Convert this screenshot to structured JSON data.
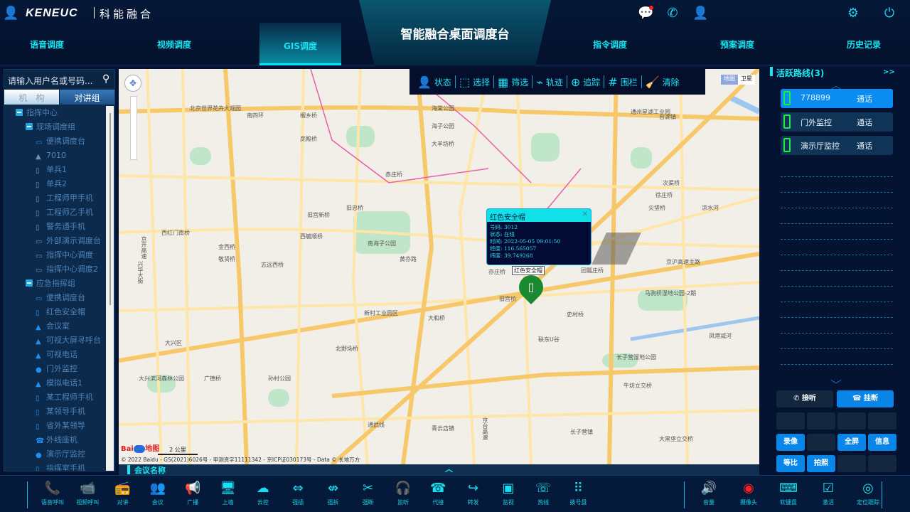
{
  "header": {
    "logo_text": "KENEUC",
    "logo_cn": "科能融合",
    "title": "智能融合桌面调度台",
    "nav": [
      {
        "label": "语音调度",
        "active": false
      },
      {
        "label": "视频调度",
        "active": false
      },
      {
        "label": "GIS调度",
        "active": true
      },
      {
        "label": "指令调度",
        "active": false
      },
      {
        "label": "预案调度",
        "active": false
      },
      {
        "label": "历史记录",
        "active": false
      }
    ],
    "icons": [
      "chat-icon",
      "phone-icon",
      "user-settings-icon",
      "gear-icon",
      "power-icon"
    ]
  },
  "left": {
    "search_placeholder": "请输入用户名或号码...",
    "tabs": [
      {
        "label": "机　构",
        "active": true
      },
      {
        "label": "对讲组",
        "active": false
      }
    ],
    "tree": [
      {
        "label": "指挥中心",
        "level": 0,
        "icon": "collapse"
      },
      {
        "label": "现场调度组",
        "level": 1,
        "icon": "collapse"
      },
      {
        "label": "便携调度台",
        "level": 2,
        "icon": "monitor",
        "online": true
      },
      {
        "label": "7010",
        "level": 2,
        "icon": "user",
        "online": false
      },
      {
        "label": "单兵1",
        "level": 2,
        "icon": "mobile",
        "online": false
      },
      {
        "label": "单兵2",
        "level": 2,
        "icon": "mobile",
        "online": false
      },
      {
        "label": "工程师甲手机",
        "level": 2,
        "icon": "mobile",
        "online": false
      },
      {
        "label": "工程师乙手机",
        "level": 2,
        "icon": "mobile",
        "online": false
      },
      {
        "label": "警务通手机",
        "level": 2,
        "icon": "mobile",
        "online": false
      },
      {
        "label": "外部演示调度台",
        "level": 2,
        "icon": "monitor",
        "online": false
      },
      {
        "label": "指挥中心调度",
        "level": 2,
        "icon": "monitor",
        "online": false
      },
      {
        "label": "指挥中心调度2",
        "level": 2,
        "icon": "monitor",
        "online": false
      },
      {
        "label": "应急指挥组",
        "level": 1,
        "icon": "collapse"
      },
      {
        "label": "便携调度台",
        "level": 2,
        "icon": "monitor",
        "online": true
      },
      {
        "label": "红色安全帽",
        "level": 2,
        "icon": "mobile",
        "online": true
      },
      {
        "label": "会议室",
        "level": 2,
        "icon": "user",
        "online": true
      },
      {
        "label": "可视大屏寻呼台",
        "level": 2,
        "icon": "user",
        "online": true
      },
      {
        "label": "可视电话",
        "level": 2,
        "icon": "user",
        "online": true
      },
      {
        "label": "门外监控",
        "level": 2,
        "icon": "camera",
        "online": true
      },
      {
        "label": "模拟电话1",
        "level": 2,
        "icon": "user",
        "online": true
      },
      {
        "label": "某工程师手机",
        "level": 2,
        "icon": "mobile",
        "online": true
      },
      {
        "label": "某领导手机",
        "level": 2,
        "icon": "mobile",
        "online": true
      },
      {
        "label": "省外某领导",
        "level": 2,
        "icon": "mobile",
        "online": true
      },
      {
        "label": "外线座机",
        "level": 2,
        "icon": "phone",
        "online": true
      },
      {
        "label": "演示厅监控",
        "level": 2,
        "icon": "camera",
        "online": true
      },
      {
        "label": "指挥室手机",
        "level": 2,
        "icon": "mobile",
        "online": true
      }
    ]
  },
  "map": {
    "toolbar": [
      {
        "label": "状态",
        "icon": "user-icon"
      },
      {
        "label": "选择",
        "icon": "select-icon"
      },
      {
        "label": "筛选",
        "icon": "filter-icon"
      },
      {
        "label": "轨迹",
        "icon": "track-icon"
      },
      {
        "label": "追踪",
        "icon": "target-icon"
      },
      {
        "label": "围栏",
        "icon": "fence-icon"
      },
      {
        "label": "清除",
        "icon": "broom-icon"
      }
    ],
    "map_type": [
      "地图",
      "卫星"
    ],
    "popup": {
      "title": "红色安全帽",
      "rows": [
        "号码:  3012",
        "状态:  在线",
        "时间:  2022-05-05 09:01:50",
        "经度:  116.565057",
        "纬度:  39.749268"
      ]
    },
    "marker_label": "红色安全帽",
    "scale": "2 公里",
    "copyright": "© 2022 Baidu - GS(2021)6026号 - 甲测资字11111342 - 京ICP证030173号 - Data © 长地万方",
    "baidu_logo": "Bai度地图",
    "places": [
      "南四环",
      "北京世界花卉大观园",
      "榴乡桥",
      "庑殿桥",
      "海棠公园",
      "大羊坊桥",
      "赤庄桥",
      "旧忠桥",
      "旧宫新桥",
      "西红门南桥",
      "金西桥",
      "敬贤桥",
      "西毓顺桥",
      "南海子公园",
      "黄亦路",
      "志远西桥",
      "亦庄桥",
      "团瓢庄桥",
      "京沪高速主路",
      "新村工业园区",
      "大和桥",
      "旧宫桥",
      "史村桥",
      "联东U谷",
      "大兴区",
      "北野场桥",
      "孙村公园",
      "广德桥",
      "通武线",
      "青云店镇",
      "长子营镇",
      "牛坊立交桥",
      "大黑垡立交桥",
      "通州星湖工业园",
      "台湖镇",
      "次渠桥",
      "尖垡桥",
      "徐庄桥",
      "马驹桥湿地公园-2期",
      "长子营湿地公园",
      "凉水河",
      "凤港减河",
      "京台高速",
      "兴华大街",
      "京开高速",
      "海子公园",
      "大兴滨河森林公园"
    ]
  },
  "meeting": {
    "title": "会议名称"
  },
  "right": {
    "title": "活跃路线(3)",
    "more": ">>",
    "calls": [
      {
        "name": "778899",
        "status": "通话",
        "selected": true
      },
      {
        "name": "门外监控",
        "status": "通话",
        "selected": false
      },
      {
        "name": "演示厅监控",
        "status": "通话",
        "selected": false
      }
    ],
    "answer": "接听",
    "hangup": "挂断",
    "grid": [
      "",
      "",
      "",
      "",
      "录像",
      "",
      "全屏",
      "信息",
      "等比",
      "拍照",
      "",
      ""
    ]
  },
  "bottom": {
    "left": [
      {
        "label": "语音呼叫",
        "icon": "voice-call-icon",
        "glyph": "📞"
      },
      {
        "label": "视频呼叫",
        "icon": "video-call-icon",
        "glyph": "📹"
      },
      {
        "label": "对讲",
        "icon": "walkie-talkie-icon",
        "glyph": "📻"
      },
      {
        "label": "会议",
        "icon": "meeting-icon",
        "glyph": "👥"
      },
      {
        "label": "广播",
        "icon": "broadcast-icon",
        "glyph": "📢"
      },
      {
        "label": "上墙",
        "icon": "screen-wall-icon",
        "glyph": "🖥"
      },
      {
        "label": "云控",
        "icon": "cloud-control-icon",
        "glyph": "☁"
      },
      {
        "label": "强插",
        "icon": "force-insert-icon",
        "glyph": "⇔"
      },
      {
        "label": "强拆",
        "icon": "force-remove-icon",
        "glyph": "⇎"
      },
      {
        "label": "强断",
        "icon": "force-break-icon",
        "glyph": "✂"
      },
      {
        "label": "监听",
        "icon": "headset-icon",
        "glyph": "🎧"
      },
      {
        "label": "代接",
        "icon": "pickup-icon",
        "glyph": "☎"
      },
      {
        "label": "转发",
        "icon": "forward-icon",
        "glyph": "↪"
      },
      {
        "label": "监视",
        "icon": "monitor-icon",
        "glyph": "▣"
      },
      {
        "label": "热线",
        "icon": "hotline-icon",
        "glyph": "☏"
      },
      {
        "label": "拨号盘",
        "icon": "dialpad-icon",
        "glyph": "⠿"
      }
    ],
    "right": [
      {
        "label": "音量",
        "icon": "volume-icon",
        "glyph": "🔊"
      },
      {
        "label": "摄像头",
        "icon": "camera-icon",
        "glyph": "◉",
        "color": "#ff2020"
      },
      {
        "label": "软键盘",
        "icon": "keyboard-icon",
        "glyph": "⌨"
      },
      {
        "label": "激活",
        "icon": "activate-icon",
        "glyph": "☑"
      },
      {
        "label": "定位跟踪",
        "icon": "locate-icon",
        "glyph": "◎"
      }
    ]
  },
  "colors": {
    "accent": "#16e0f0",
    "primary_button": "#0a86e8",
    "online_icon": "#1e8ef0",
    "offline_icon": "#4e6e90",
    "phone_icon": "#1aee40",
    "camera_off": "#ff2020"
  }
}
